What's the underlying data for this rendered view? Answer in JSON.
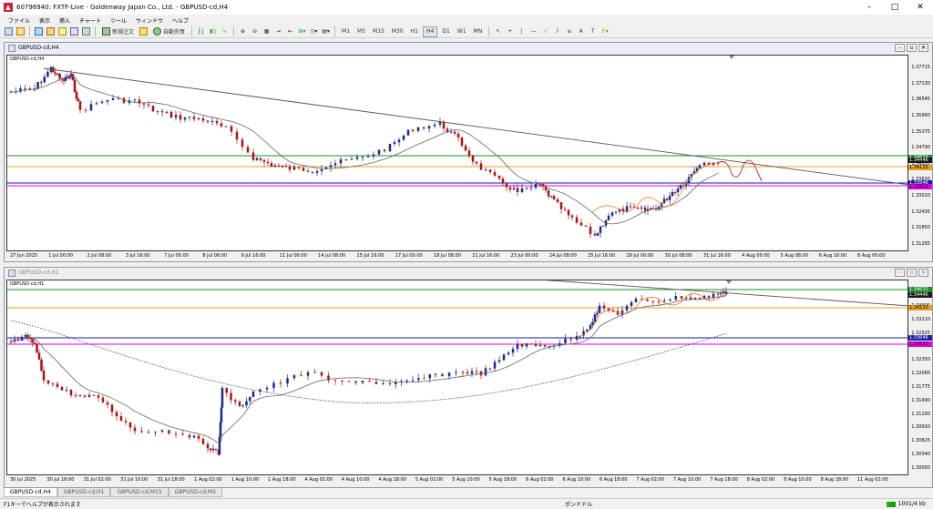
{
  "window": {
    "title": "60796940: FXTF-Live - Goldenway Japan Co., Ltd. - GBPUSD-cd,H4",
    "minimize": "–",
    "maximize": "□",
    "close": "✕"
  },
  "menu": [
    "ファイル",
    "表示",
    "挿入",
    "チャート",
    "ツール",
    "ウィンドウ",
    "ヘルプ"
  ],
  "toolbar": {
    "new_order": "新規注文",
    "auto_trade": "自動売買",
    "timeframes": [
      "M1",
      "M5",
      "M15",
      "M30",
      "H1",
      "H4",
      "D1",
      "W1",
      "MN"
    ]
  },
  "chart_top": {
    "window_title": "GBPUSD-cd,H4",
    "symbol_label": "GBPUSD-cd,H4",
    "y_ticks": [
      "1.37715",
      "1.37130",
      "1.36545",
      "1.35960",
      "1.35375",
      "1.34790",
      "1.34205",
      "1.33620",
      "1.33020",
      "1.32435",
      "1.31850",
      "1.31265"
    ],
    "price_tags": [
      {
        "value": "1.34633",
        "color": "#1a8f2a"
      },
      {
        "value": "1.34446",
        "color": "#1a1a1a"
      },
      {
        "value": "1.34133",
        "color": "#e8a020"
      },
      {
        "value": "1.33648",
        "color": "#1a1aaa"
      },
      {
        "value": "1.33512",
        "color": "#e000e0"
      }
    ],
    "x_labels": [
      "27 Jun 2025",
      "1 Jul 00:00",
      "2 Jul 08:00",
      "3 Jul 16:00",
      "7 Jul 00:00",
      "8 Jul 08:00",
      "9 Jul 16:00",
      "11 Jul 00:00",
      "14 Jul 08:00",
      "15 Jul 16:00",
      "17 Jul 00:00",
      "18 Jul 08:00",
      "21 Jul 16:00",
      "23 Jul 00:00",
      "24 Jul 08:00",
      "25 Jul 16:00",
      "29 Jul 00:00",
      "30 Jul 08:00",
      "31 Jul 16:00",
      "4 Aug 00:00",
      "5 Aug 08:00",
      "6 Aug 16:00",
      "8 Aug 00:00"
    ]
  },
  "chart_bottom": {
    "window_title": "GBPUSD-cd,H1",
    "symbol_label": "GBPUSD-cd,H1",
    "y_ticks": [
      "1.33790",
      "1.33500",
      "1.33210",
      "1.32925",
      "1.32640",
      "1.32350",
      "1.32060",
      "1.31775",
      "1.31490",
      "1.31200",
      "1.30910",
      "1.30625",
      "1.30340",
      "1.30050"
    ],
    "price_tags": [
      {
        "value": "1.34633",
        "color": "#1a8f2a"
      },
      {
        "value": "1.34446",
        "color": "#1a1a1a"
      },
      {
        "value": "1.34133",
        "color": "#e8a020"
      },
      {
        "value": "1.33648",
        "color": "#1a1aaa"
      },
      {
        "value": "1.33512",
        "color": "#e000e0"
      }
    ],
    "x_labels": [
      "30 Jul 2025",
      "30 Jul 18:00",
      "31 Jul 02:00",
      "31 Jul 10:00",
      "31 Jul 18:00",
      "1 Aug 02:00",
      "1 Aug 10:00",
      "1 Aug 18:00",
      "4 Aug 02:00",
      "4 Aug 10:00",
      "4 Aug 18:00",
      "5 Aug 02:00",
      "5 Aug 10:00",
      "5 Aug 18:00",
      "6 Aug 02:00",
      "6 Aug 10:00",
      "6 Aug 18:00",
      "7 Aug 02:00",
      "7 Aug 10:00",
      "7 Aug 18:00",
      "8 Aug 02:00",
      "8 Aug 10:00",
      "8 Aug 18:00",
      "11 Aug 02:00"
    ]
  },
  "tabs": [
    "GBPUSD-cd,H4",
    "GBPUSD-cd,H1",
    "GBPUSD-cd,M15",
    "GBPUSD-cd,M5"
  ],
  "status": {
    "help": "F1キーでヘルプが表示されます",
    "profile": "ポンドドル",
    "connection": "1001/4 kb"
  },
  "colors": {
    "bull": "#1a2a8a",
    "bear": "#b01010"
  }
}
